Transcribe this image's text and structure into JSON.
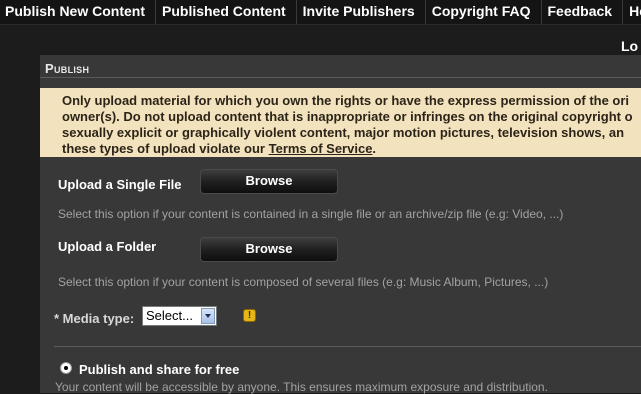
{
  "nav": {
    "items": [
      {
        "label": "Publish New Content"
      },
      {
        "label": "Published Content"
      },
      {
        "label": "Invite Publishers"
      },
      {
        "label": "Copyright FAQ"
      },
      {
        "label": "Feedback"
      },
      {
        "label": "He"
      }
    ],
    "logout_label": "Lo"
  },
  "publish": {
    "title": "Publish",
    "notice_lines": [
      "Only upload material for which you own the rights or have the express permission of the ori",
      "owner(s). Do not upload content that is inappropriate or infringes on the original copyright o",
      "sexually explicit or graphically violent content, major motion pictures, television shows, an",
      "these types of upload violate our"
    ],
    "notice_link": "Terms of Service",
    "notice_end": ".",
    "single_file": {
      "label": "Upload a Single File",
      "button": "Browse",
      "hint": "Select this option if your content is contained in a single file or an archive/zip file (e.g: Video, ...)"
    },
    "folder": {
      "label": "Upload a Folder",
      "button": "Browse",
      "hint": "Select this option if your content is composed of several files (e.g: Music Album, Pictures, ...)"
    },
    "media_type": {
      "label": "* Media type:",
      "selected": "Select..."
    },
    "warning_glyph": "!",
    "option_free": {
      "label": "Publish and share for free",
      "description": "Your content will be accessible by anyone. This ensures maximum exposure and distribution."
    }
  }
}
